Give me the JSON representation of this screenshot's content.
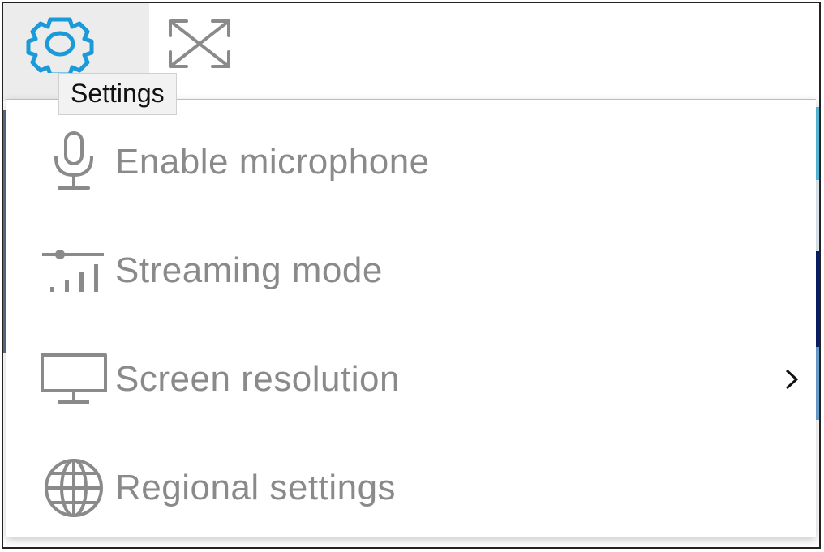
{
  "toolbar": {
    "settings_button": {
      "icon": "gear-icon",
      "color": "#1a9ad8",
      "active": true
    },
    "fullscreen_button": {
      "icon": "fullscreen-expand-icon",
      "color": "#8a8a8a"
    }
  },
  "tooltip": {
    "text": "Settings"
  },
  "menu": {
    "items": [
      {
        "label": "Enable microphone",
        "icon": "microphone-icon",
        "has_submenu": false
      },
      {
        "label": "Streaming mode",
        "icon": "signal-slider-icon",
        "has_submenu": false
      },
      {
        "label": "Screen resolution",
        "icon": "monitor-icon",
        "has_submenu": true,
        "submenu_indicator": ">"
      },
      {
        "label": "Regional settings",
        "icon": "globe-icon",
        "has_submenu": false
      }
    ],
    "label_color": "#8a8a8a"
  }
}
